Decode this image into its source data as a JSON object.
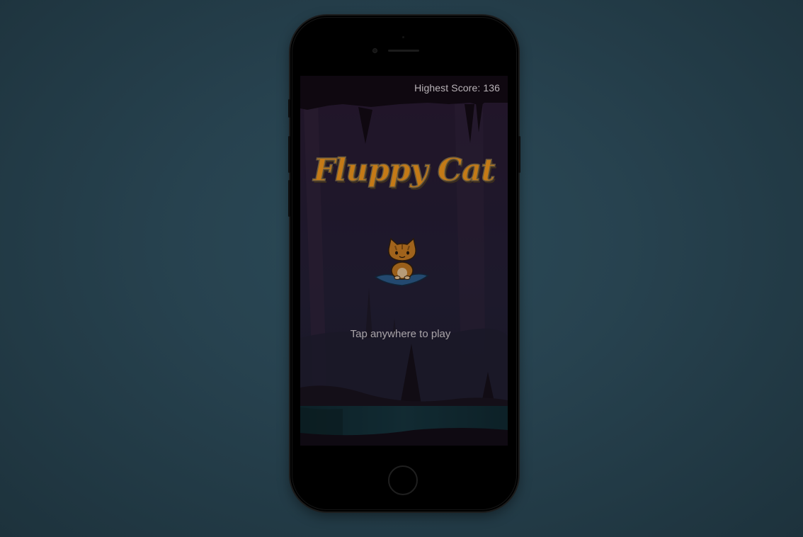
{
  "game": {
    "title": "Fluppy Cat",
    "highest_score_label": "Highest Score:",
    "highest_score_value": "136",
    "tap_prompt": "Tap anywhere to play"
  },
  "colors": {
    "background": "#27424f",
    "title": "#c47a17",
    "cat": "#b8701c",
    "carpet": "#2f5c8a",
    "overlay_text": "#b9b3b8"
  },
  "icons": {
    "player": "cat-on-carpet-icon",
    "home": "home-button-icon"
  }
}
